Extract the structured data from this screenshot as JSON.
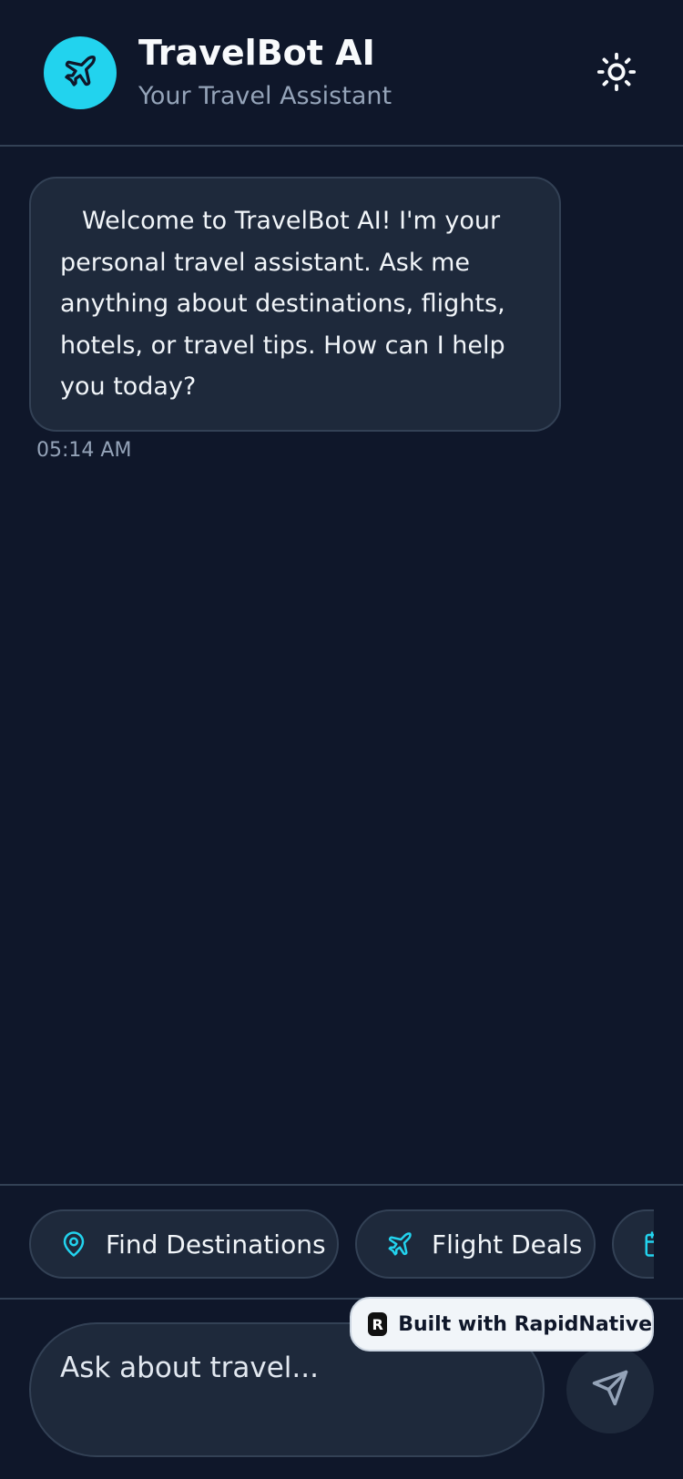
{
  "header": {
    "title": "TravelBot AI",
    "subtitle": "Your Travel Assistant",
    "logo_icon": "airplane-icon",
    "theme_toggle_icon": "sun-icon"
  },
  "messages": [
    {
      "sender": "bot",
      "text": "Welcome to TravelBot AI! I'm your personal travel assistant. Ask me anything about destinations, flights, hotels, or travel tips. How can I help you today?",
      "time": "05:14 AM"
    }
  ],
  "quick_actions": [
    {
      "label": "Find Destinations",
      "icon": "map-pin-icon"
    },
    {
      "label": "Flight Deals",
      "icon": "airplane-icon"
    },
    {
      "label": "",
      "icon": "calendar-icon"
    }
  ],
  "composer": {
    "placeholder": "Ask about travel...",
    "send_icon": "send-icon"
  },
  "badge": {
    "label": "Built with RapidNative",
    "mark": "R"
  },
  "colors": {
    "background": "#0f172a",
    "surface": "#1e293b",
    "border": "#334155",
    "accent": "#22d3ee",
    "muted_text": "#94a3b8"
  }
}
